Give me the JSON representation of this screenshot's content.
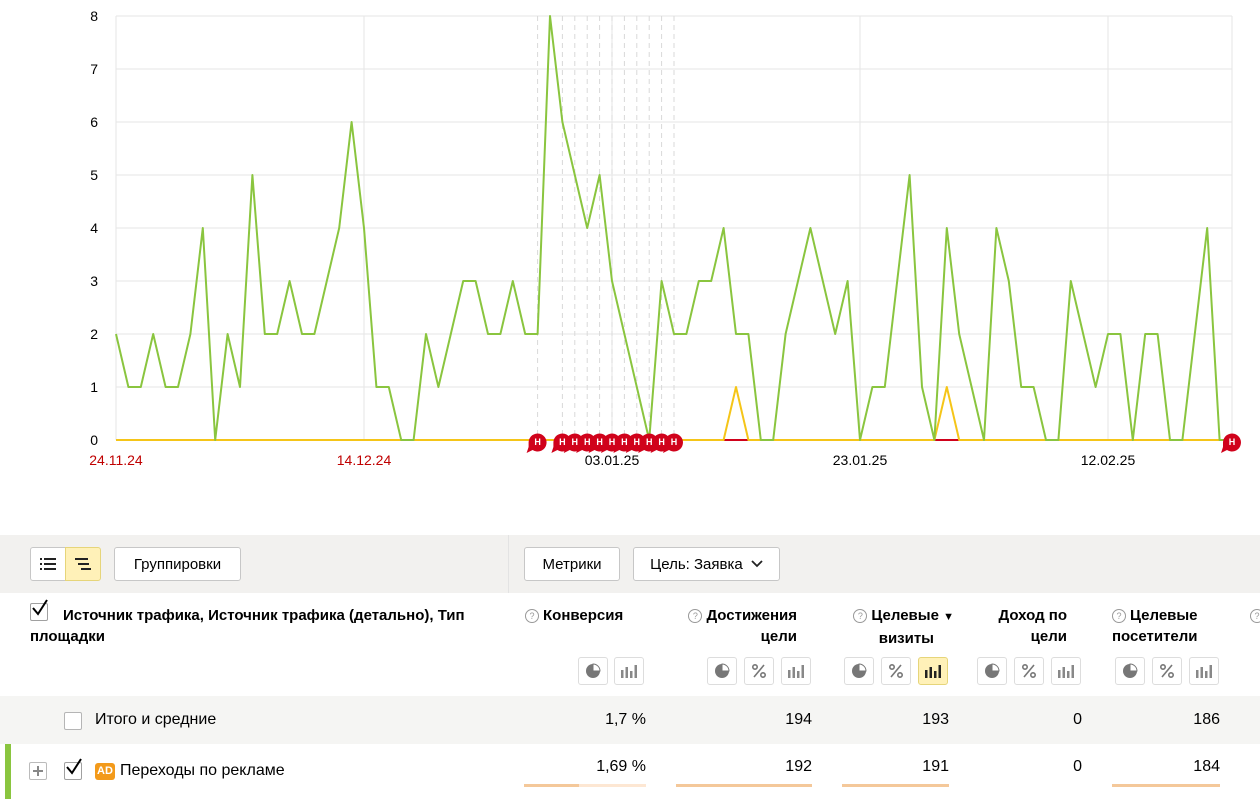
{
  "chart_data": {
    "type": "line",
    "y_ticks": [
      "0",
      "1",
      "2",
      "3",
      "4",
      "5",
      "6",
      "7",
      "8"
    ],
    "ylim": [
      0,
      8
    ],
    "x_ticks": [
      {
        "label": "24.11.24",
        "color": "#c00000"
      },
      {
        "label": "14.12.24",
        "color": "#c00000"
      },
      {
        "label": "03.01.25",
        "color": "#000000"
      },
      {
        "label": "23.01.25",
        "color": "#000000"
      },
      {
        "label": "12.02.25",
        "color": "#000000"
      }
    ],
    "x_start": "24.11.24",
    "series": [
      {
        "color": "#8ac53f",
        "values": [
          2,
          1,
          1,
          2,
          1,
          1,
          2,
          4,
          0,
          2,
          1,
          5,
          2,
          2,
          3,
          2,
          2,
          3,
          4,
          6,
          4,
          1,
          1,
          0,
          0,
          2,
          1,
          2,
          3,
          3,
          2,
          2,
          3,
          2,
          2,
          8,
          6,
          5,
          4,
          5,
          3,
          2,
          1,
          0,
          3,
          2,
          2,
          3,
          3,
          4,
          2,
          2,
          0,
          0,
          2,
          3,
          4,
          3,
          2,
          3,
          0,
          1,
          1,
          3,
          5,
          1,
          0,
          4,
          2,
          1,
          0,
          4,
          3,
          1,
          1,
          0,
          0,
          3,
          2,
          1,
          2,
          2,
          0,
          2,
          2,
          0,
          0,
          2,
          4,
          0,
          0
        ]
      },
      {
        "color": "#f5c518",
        "values": [
          0,
          0,
          0,
          0,
          0,
          0,
          0,
          0,
          0,
          0,
          0,
          0,
          0,
          0,
          0,
          0,
          0,
          0,
          0,
          0,
          0,
          0,
          0,
          0,
          0,
          0,
          0,
          0,
          0,
          0,
          0,
          0,
          0,
          0,
          0,
          0,
          0,
          0,
          0,
          0,
          0,
          0,
          0,
          0,
          0,
          0,
          0,
          0,
          0,
          0,
          1,
          0,
          0,
          0,
          0,
          0,
          0,
          0,
          0,
          0,
          0,
          0,
          0,
          0,
          0,
          0,
          0,
          1,
          0,
          0,
          0,
          0,
          0,
          0,
          0,
          0,
          0,
          0,
          0,
          0,
          0,
          0,
          0,
          0,
          0,
          0,
          0,
          0,
          0,
          0,
          0
        ]
      },
      {
        "color": "#d0021b",
        "values": [
          0,
          0,
          0,
          0,
          0,
          0,
          0,
          0,
          0,
          0,
          0,
          0,
          0,
          0,
          0,
          0,
          0,
          0,
          0,
          0,
          0,
          0,
          0,
          0,
          0,
          0,
          0,
          0,
          0,
          0,
          0,
          0,
          0,
          0,
          0,
          0,
          0,
          0,
          0,
          0,
          0,
          0,
          0,
          0,
          0,
          0,
          0,
          0,
          0,
          0,
          0,
          0,
          0,
          0,
          0,
          0,
          0,
          0,
          0,
          0,
          0,
          0,
          0,
          0,
          0,
          0,
          0,
          0,
          0,
          0,
          0,
          0,
          0,
          0,
          0,
          0,
          0,
          0,
          0,
          0,
          0,
          0,
          0,
          0,
          0,
          0,
          0,
          0,
          0,
          0,
          0
        ]
      }
    ],
    "holiday_marker_label": "Н",
    "holiday_days": [
      34,
      36,
      37,
      38,
      39,
      40,
      41,
      42,
      43,
      44,
      45,
      91
    ]
  },
  "toolbar": {
    "list_icon": "list-icon",
    "tree_icon": "tree-icon",
    "groupings_label": "Группировки",
    "metrics_label": "Метрики",
    "goal_label": "Цель: Заявка"
  },
  "table": {
    "dimension_header": "Источник трафика, Источник трафика (детально), Тип площадки",
    "columns": [
      {
        "title_l1": "Конверсия",
        "title_l2": "",
        "help": true
      },
      {
        "title_l1": "Достижения",
        "title_l2": "цели",
        "help": true
      },
      {
        "title_l1": "Целевые",
        "title_l2": "визиты",
        "help": true,
        "sort": "▼"
      },
      {
        "title_l1": "Доход по",
        "title_l2": "цели",
        "help": false
      },
      {
        "title_l1": "Целевые",
        "title_l2": "посетители",
        "help": true
      }
    ],
    "total_row": {
      "label": "Итого и средние",
      "values": [
        "1,7 %",
        "194",
        "193",
        "0",
        "186"
      ]
    },
    "ads_row": {
      "badge": "AD",
      "label": "Переходы по рекламе",
      "values": [
        "1,69 %",
        "192",
        "191",
        "0",
        "184"
      ],
      "bar_fill": [
        0.45,
        1.0,
        1.0,
        0,
        1.0
      ]
    }
  }
}
